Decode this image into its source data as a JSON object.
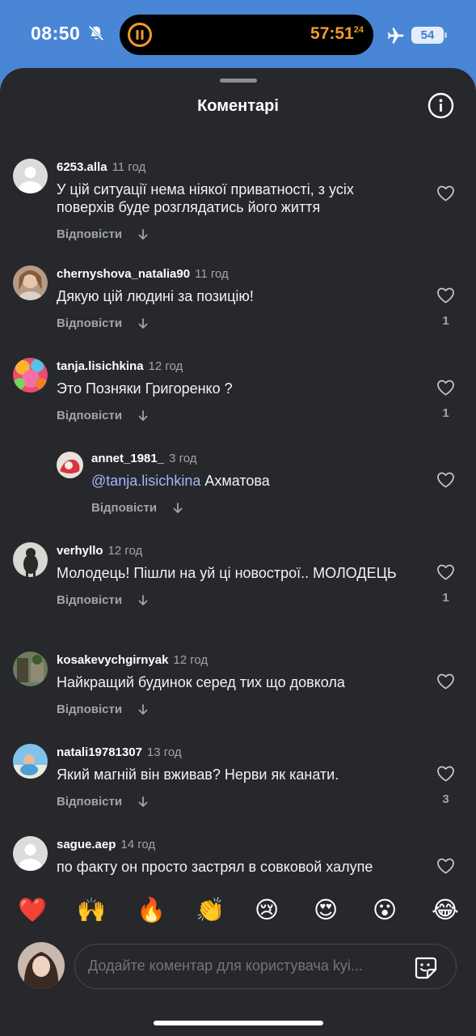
{
  "status": {
    "time": "08:50",
    "timer": "57:51",
    "timer_sup": "24",
    "battery": "54"
  },
  "sheet": {
    "title": "Коментарі"
  },
  "comments": [
    {
      "user": "6253.alla",
      "time": "11 год",
      "text": "У цій ситуації нема ніякої приватності, з усіх поверхів буде розглядатись його життя",
      "reply": "Відповісти",
      "likes": ""
    },
    {
      "user": "chernyshova_natalia90",
      "time": "11 год",
      "text": "Дякую цій людині за позицію!",
      "reply": "Відповісти",
      "likes": "1"
    },
    {
      "user": "tanja.lisichkina",
      "time": "12 год",
      "text": "Это Позняки Григоренко ?",
      "reply": "Відповісти",
      "likes": "1"
    },
    {
      "user": "annet_1981_",
      "time": "3 год",
      "mention": "@tanja.lisichkina",
      "text": "Ахматова",
      "reply": "Відповісти",
      "likes": ""
    },
    {
      "user": "verhyllo",
      "time": "12 год",
      "text": "Молодець! Пішли на уй ці новострої.. МОЛОДЕЦЬ",
      "reply": "Відповісти",
      "likes": "1"
    },
    {
      "user": "kosakevychgirnyak",
      "time": "12 год",
      "text": "Найкращий будинок серед тих що довкола",
      "reply": "Відповісти",
      "likes": ""
    },
    {
      "user": "natali19781307",
      "time": "13 год",
      "text": "Який магній він вживав? Нерви як канати.",
      "reply": "Відповісти",
      "likes": "3"
    },
    {
      "user": "sague.aep",
      "time": "14 год",
      "text": "по факту он просто застрял в совковой халупе",
      "reply": "",
      "likes": ""
    }
  ],
  "emojis": [
    "❤️",
    "🙌",
    "🔥",
    "👏",
    "😢",
    "😍",
    "😮",
    "😂"
  ],
  "composer": {
    "placeholder": "Додайте коментар для користувача kyi..."
  },
  "icons": {
    "bell": "bell-slash-icon",
    "timer": "pause-timer-icon",
    "plane": "airplane-icon",
    "info": "info-icon",
    "like": "heart-outline-icon",
    "arrow": "arrow-down-icon",
    "sticker": "sticker-icon"
  },
  "colors": {
    "sheet_bg": "#26282b",
    "mention": "#a4b5ff",
    "timer": "#f19a2a",
    "muted": "#a2a4a8"
  }
}
